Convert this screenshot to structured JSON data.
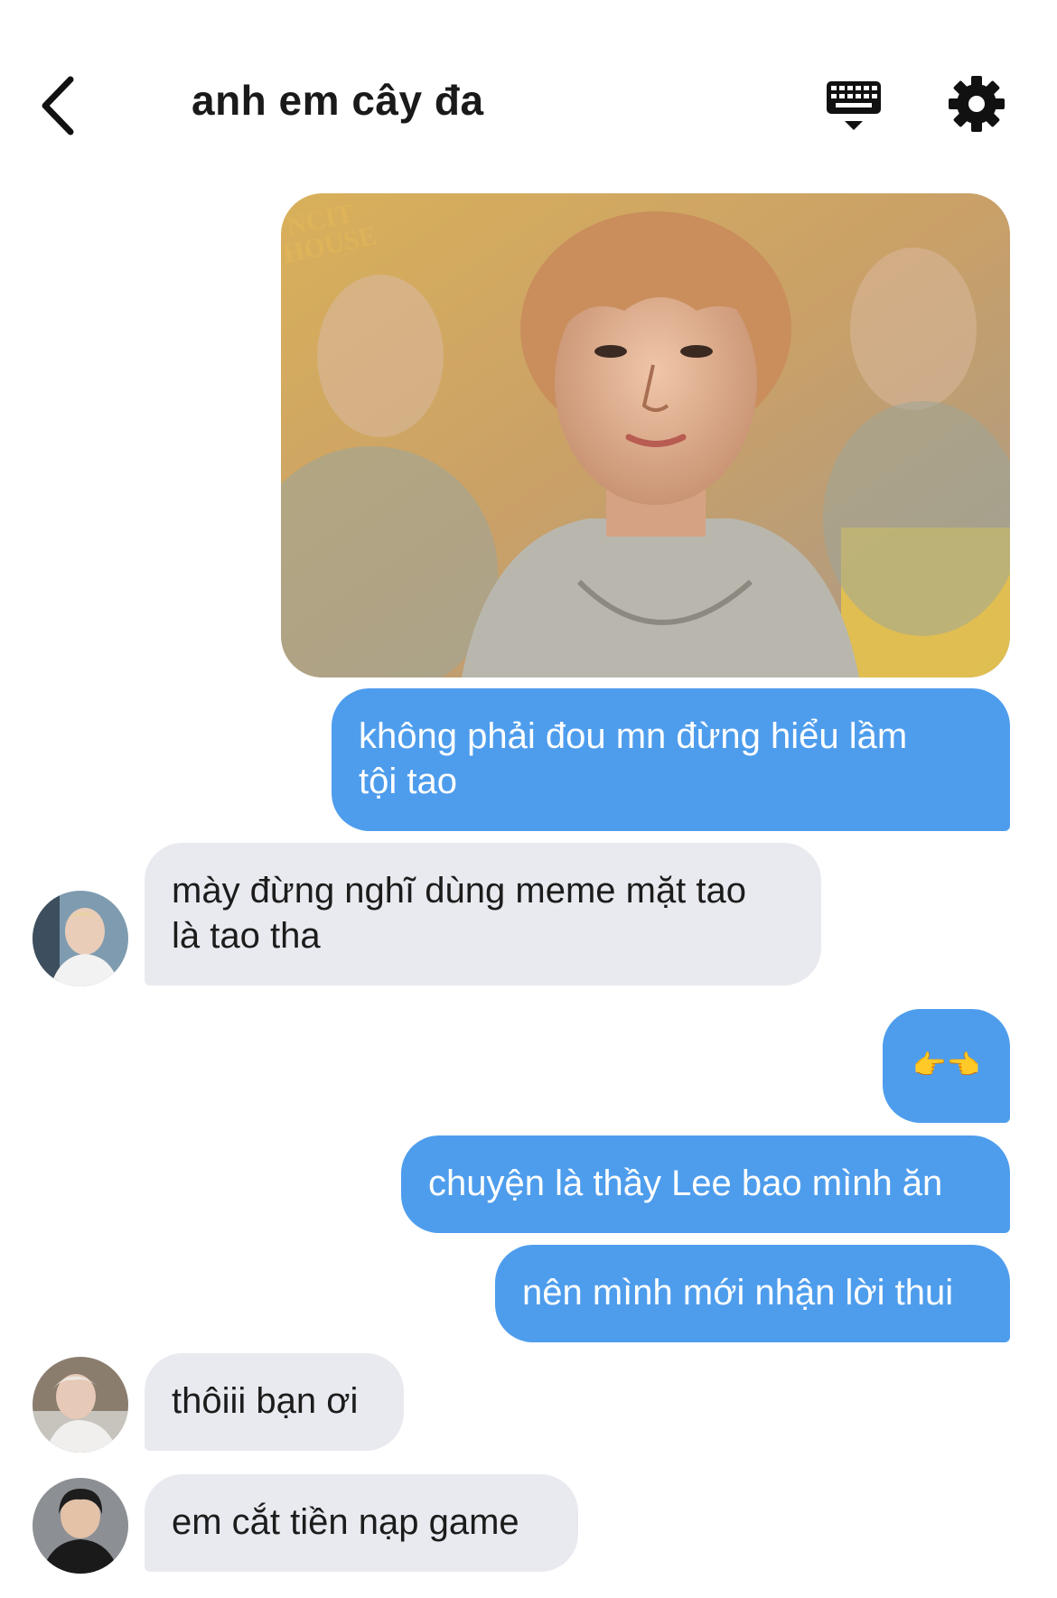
{
  "header": {
    "title": "anh em cây đa",
    "back_icon": "chevron-left-icon",
    "keyboard_icon": "keyboard-icon",
    "settings_icon": "gear-icon"
  },
  "colors": {
    "outgoing_bubble": "#4e9ded",
    "incoming_bubble": "#e9eaef"
  },
  "messages": [
    {
      "from": "me",
      "type": "image",
      "watermark": "NCIT HOUSE"
    },
    {
      "from": "me",
      "text_lines": [
        "không phải đou mn đừng hiểu lầm",
        "tội tao"
      ]
    },
    {
      "from": "other",
      "text_lines": [
        "mày đừng nghĩ dùng meme mặt tao",
        "là tao tha"
      ]
    },
    {
      "from": "me",
      "text": "👉👈"
    },
    {
      "from": "me",
      "text": "chuyện là thầy Lee bao mình ăn"
    },
    {
      "from": "me",
      "text": "nên mình mới nhận lời thui"
    },
    {
      "from": "other",
      "text": "thôiii bạn ơi"
    },
    {
      "from": "other",
      "text": "em cắt tiền nạp game"
    }
  ]
}
